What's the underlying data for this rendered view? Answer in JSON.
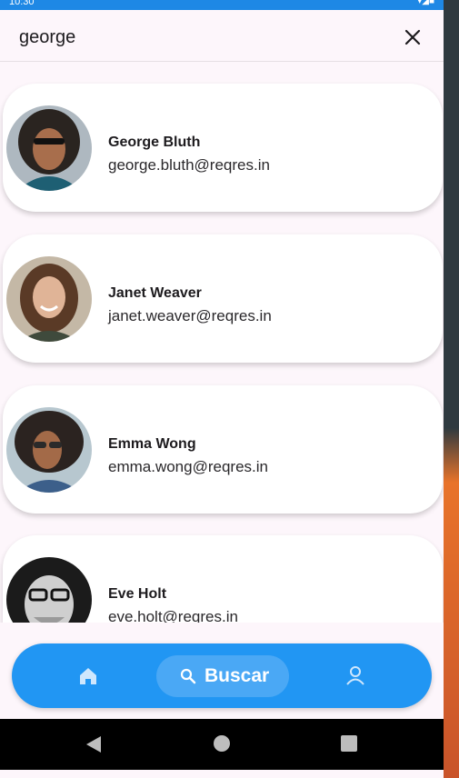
{
  "status_bar": {
    "time": "10:30",
    "icons": "▾◢■"
  },
  "search": {
    "query": "george"
  },
  "users": [
    {
      "name": "George Bluth",
      "email": "george.bluth@reqres.in"
    },
    {
      "name": "Janet Weaver",
      "email": "janet.weaver@reqres.in"
    },
    {
      "name": "Emma Wong",
      "email": "emma.wong@reqres.in"
    },
    {
      "name": "Eve Holt",
      "email": "eve.holt@reqres.in"
    }
  ],
  "bottom_nav": {
    "search_label": "Buscar",
    "active": "search"
  },
  "colors": {
    "accent": "#2196f3",
    "active_pill": "#4aa8f5",
    "background": "#fdf6fb"
  }
}
